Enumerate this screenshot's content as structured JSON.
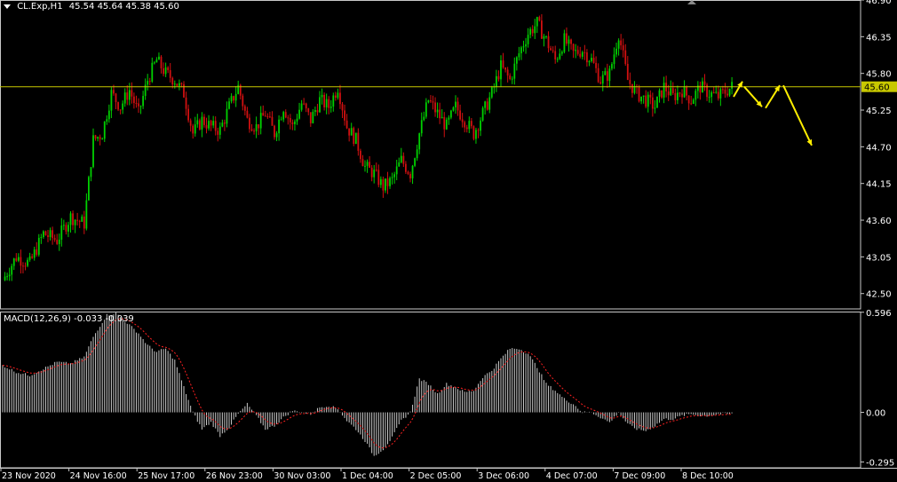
{
  "header": {
    "symbol_timeframe": "CL.Exp,H1",
    "ohlc": "45.54 45.64 45.38 45.60",
    "menu_icon": "triangle-down-icon",
    "scroll_marker_icon": "triangle-up-icon"
  },
  "indicator": {
    "label": "MACD(12,26,9)",
    "values": "-0.033 -0.039"
  },
  "price_line": {
    "label": "45.60",
    "value": 45.6,
    "color": "#c8c800"
  },
  "colors": {
    "bull": "#00d000",
    "bear": "#d01010",
    "macd_hist": "#c8c8c8",
    "signal": "#ff2020",
    "arrow": "#ffee00",
    "frame": "#c8c8c8"
  },
  "chart_data": [
    {
      "type": "candlestick",
      "ylim": [
        42.27,
        46.9
      ],
      "yticks": [
        "46.90",
        "46.35",
        "45.80",
        "45.25",
        "44.70",
        "44.15",
        "43.60",
        "43.05",
        "42.50"
      ],
      "ytick_values": [
        46.9,
        46.35,
        45.8,
        45.25,
        44.7,
        44.15,
        43.6,
        43.05,
        42.5
      ],
      "xticks": [
        "23 Nov 2020",
        "24 Nov 16:00",
        "25 Nov 17:00",
        "26 Nov 23:00",
        "30 Nov 03:00",
        "1 Dec 04:00",
        "2 Dec 05:00",
        "3 Dec 06:00",
        "4 Dec 07:00",
        "7 Dec 09:00",
        "8 Dec 10:00"
      ],
      "close_path": [
        [
          0,
          42.7
        ],
        [
          6,
          43.05
        ],
        [
          12,
          42.95
        ],
        [
          18,
          43.4
        ],
        [
          24,
          43.3
        ],
        [
          30,
          43.65
        ],
        [
          36,
          43.55
        ],
        [
          40,
          44.8
        ],
        [
          44,
          44.9
        ],
        [
          48,
          45.5
        ],
        [
          52,
          45.3
        ],
        [
          56,
          45.55
        ],
        [
          60,
          45.2
        ],
        [
          64,
          45.7
        ],
        [
          68,
          46.0
        ],
        [
          72,
          45.8
        ],
        [
          76,
          45.7
        ],
        [
          80,
          45.5
        ],
        [
          84,
          44.9
        ],
        [
          88,
          45.1
        ],
        [
          92,
          45.0
        ],
        [
          96,
          44.95
        ],
        [
          100,
          45.3
        ],
        [
          104,
          45.6
        ],
        [
          108,
          45.1
        ],
        [
          112,
          45.0
        ],
        [
          116,
          45.2
        ],
        [
          120,
          44.9
        ],
        [
          124,
          45.3
        ],
        [
          128,
          45.0
        ],
        [
          132,
          45.35
        ],
        [
          136,
          45.1
        ],
        [
          140,
          45.4
        ],
        [
          144,
          45.3
        ],
        [
          148,
          45.6
        ],
        [
          152,
          45.0
        ],
        [
          156,
          44.8
        ],
        [
          160,
          44.4
        ],
        [
          164,
          44.3
        ],
        [
          168,
          44.1
        ],
        [
          172,
          44.2
        ],
        [
          176,
          44.5
        ],
        [
          180,
          44.3
        ],
        [
          184,
          44.9
        ],
        [
          188,
          45.4
        ],
        [
          192,
          45.2
        ],
        [
          196,
          45.0
        ],
        [
          200,
          45.3
        ],
        [
          204,
          45.1
        ],
        [
          208,
          44.9
        ],
        [
          212,
          45.2
        ],
        [
          216,
          45.5
        ],
        [
          220,
          45.9
        ],
        [
          224,
          45.7
        ],
        [
          228,
          46.1
        ],
        [
          232,
          46.4
        ],
        [
          236,
          46.55
        ],
        [
          240,
          46.3
        ],
        [
          244,
          46.0
        ],
        [
          248,
          46.3
        ],
        [
          252,
          46.1
        ],
        [
          256,
          46.15
        ],
        [
          260,
          46.0
        ],
        [
          264,
          45.7
        ],
        [
          268,
          45.8
        ],
        [
          272,
          46.4
        ],
        [
          276,
          45.7
        ],
        [
          280,
          45.5
        ],
        [
          284,
          45.4
        ],
        [
          288,
          45.3
        ],
        [
          292,
          45.6
        ],
        [
          296,
          45.45
        ],
        [
          300,
          45.55
        ],
        [
          304,
          45.4
        ],
        [
          308,
          45.6
        ],
        [
          312,
          45.5
        ],
        [
          316,
          45.45
        ],
        [
          320,
          45.55
        ],
        [
          322,
          45.6
        ]
      ]
    },
    {
      "type": "histogram",
      "name": "MACD(12,26,9)",
      "ylim": [
        -0.33,
        0.6
      ],
      "yticks": [
        "0.596",
        "0.00",
        "-0.295"
      ],
      "ytick_values": [
        0.596,
        0.0,
        -0.295
      ],
      "histogram_path": [
        [
          0,
          0.28
        ],
        [
          6,
          0.24
        ],
        [
          12,
          0.22
        ],
        [
          18,
          0.26
        ],
        [
          24,
          0.3
        ],
        [
          30,
          0.29
        ],
        [
          36,
          0.33
        ],
        [
          40,
          0.45
        ],
        [
          46,
          0.58
        ],
        [
          50,
          0.59
        ],
        [
          56,
          0.52
        ],
        [
          60,
          0.47
        ],
        [
          64,
          0.4
        ],
        [
          68,
          0.36
        ],
        [
          72,
          0.38
        ],
        [
          76,
          0.31
        ],
        [
          80,
          0.15
        ],
        [
          84,
          0.0
        ],
        [
          88,
          -0.1
        ],
        [
          92,
          -0.06
        ],
        [
          96,
          -0.14
        ],
        [
          100,
          -0.09
        ],
        [
          104,
          -0.01
        ],
        [
          108,
          0.05
        ],
        [
          112,
          -0.02
        ],
        [
          116,
          -0.1
        ],
        [
          120,
          -0.08
        ],
        [
          124,
          -0.03
        ],
        [
          128,
          0.01
        ],
        [
          132,
          0.0
        ],
        [
          136,
          -0.01
        ],
        [
          140,
          0.03
        ],
        [
          144,
          0.04
        ],
        [
          148,
          0.02
        ],
        [
          152,
          -0.05
        ],
        [
          156,
          -0.1
        ],
        [
          160,
          -0.17
        ],
        [
          164,
          -0.26
        ],
        [
          168,
          -0.22
        ],
        [
          172,
          -0.15
        ],
        [
          176,
          -0.05
        ],
        [
          180,
          0.0
        ],
        [
          184,
          0.2
        ],
        [
          188,
          0.17
        ],
        [
          192,
          0.11
        ],
        [
          196,
          0.17
        ],
        [
          200,
          0.15
        ],
        [
          204,
          0.12
        ],
        [
          208,
          0.13
        ],
        [
          212,
          0.21
        ],
        [
          216,
          0.25
        ],
        [
          220,
          0.32
        ],
        [
          224,
          0.38
        ],
        [
          228,
          0.38
        ],
        [
          232,
          0.35
        ],
        [
          236,
          0.27
        ],
        [
          240,
          0.17
        ],
        [
          244,
          0.13
        ],
        [
          248,
          0.08
        ],
        [
          252,
          0.05
        ],
        [
          256,
          0.0
        ],
        [
          260,
          0.0
        ],
        [
          264,
          -0.03
        ],
        [
          268,
          -0.06
        ],
        [
          272,
          0.0
        ],
        [
          276,
          -0.07
        ],
        [
          280,
          -0.1
        ],
        [
          284,
          -0.11
        ],
        [
          288,
          -0.08
        ],
        [
          292,
          -0.04
        ],
        [
          296,
          -0.04
        ],
        [
          300,
          -0.02
        ],
        [
          304,
          -0.01
        ],
        [
          308,
          -0.02
        ],
        [
          312,
          -0.02
        ],
        [
          316,
          -0.01
        ],
        [
          320,
          -0.01
        ],
        [
          322,
          -0.01
        ]
      ]
    }
  ],
  "projection_arrows": [
    {
      "from": [
        45.45,
        826
      ],
      "to": [
        45.68,
        836
      ]
    },
    {
      "from": [
        45.6,
        838
      ],
      "to": [
        45.3,
        858
      ]
    },
    {
      "from": [
        45.28,
        862
      ],
      "to": [
        45.62,
        878
      ]
    },
    {
      "from": [
        45.62,
        882
      ],
      "to": [
        44.72,
        914
      ]
    }
  ]
}
